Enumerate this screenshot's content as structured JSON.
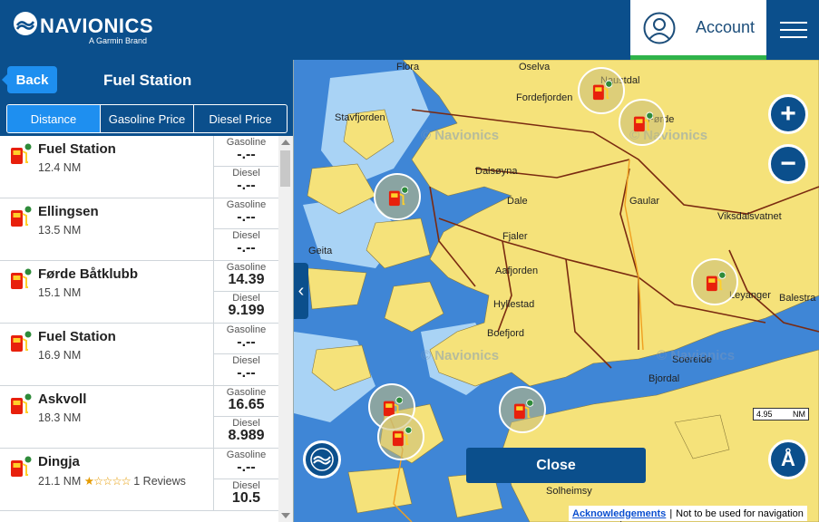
{
  "header": {
    "logo_text": "NAVIONICS",
    "logo_sub": "A Garmin Brand",
    "account_label": "Account"
  },
  "panel": {
    "back_label": "Back",
    "title": "Fuel Station",
    "sort_tabs": [
      "Distance",
      "Gasoline Price",
      "Diesel Price"
    ],
    "active_tab": "Distance",
    "price_labels": {
      "gasoline": "Gasoline",
      "diesel": "Diesel"
    },
    "items": [
      {
        "name": "Fuel Station",
        "distance": "12.4 NM",
        "gasoline": "-.--",
        "diesel": "-.--"
      },
      {
        "name": "Ellingsen",
        "distance": "13.5 NM",
        "gasoline": "-.--",
        "diesel": "-.--"
      },
      {
        "name": "Førde Båtklubb",
        "distance": "15.1 NM",
        "gasoline": "14.39",
        "diesel": "9.199"
      },
      {
        "name": "Fuel Station",
        "distance": "16.9 NM",
        "gasoline": "-.--",
        "diesel": "-.--"
      },
      {
        "name": "Askvoll",
        "distance": "18.3 NM",
        "gasoline": "16.65",
        "diesel": "8.989"
      },
      {
        "name": "Dingja",
        "distance": "21.1 NM",
        "stars": "★☆☆☆☆",
        "reviews": "1 Reviews",
        "gasoline": "-.--",
        "diesel": "10.5"
      }
    ]
  },
  "map": {
    "labels": [
      {
        "text": "Flora"
      },
      {
        "text": "Oselva"
      },
      {
        "text": "Naustdal"
      },
      {
        "text": "Fordefjorden"
      },
      {
        "text": "Stavfjorden"
      },
      {
        "text": "Førde"
      },
      {
        "text": "Dalsøyna"
      },
      {
        "text": "Dale"
      },
      {
        "text": "Gaular"
      },
      {
        "text": "Viksdalsvatnet"
      },
      {
        "text": "Geita"
      },
      {
        "text": "Fjaler"
      },
      {
        "text": "Aafjorden"
      },
      {
        "text": "Hyllestad"
      },
      {
        "text": "Leyanger"
      },
      {
        "text": "Balestra"
      },
      {
        "text": "Boefjord"
      },
      {
        "text": "Soereide"
      },
      {
        "text": "Bjordal"
      },
      {
        "text": "Solheimsy"
      },
      {
        "text": "Hyllestad"
      }
    ],
    "watermarks": [
      "© Navionics",
      "© Navionics",
      "© Navionics",
      "© Navionics"
    ],
    "collapse_icon": "‹",
    "zoom_in": "+",
    "zoom_out": "−",
    "close_label": "Close",
    "scale_value": "4.95",
    "scale_unit": "NM",
    "tracker_icon": "Å",
    "ack_label": "Acknowledgements",
    "ack_separator": "|",
    "disclaimer": "Not to be used for navigation"
  },
  "colors": {
    "brand": "#0b4f8c",
    "accent": "#1e8ff0",
    "account_bar": "#2fb34a",
    "water": "#3f86d6",
    "land": "#f5e27a"
  }
}
